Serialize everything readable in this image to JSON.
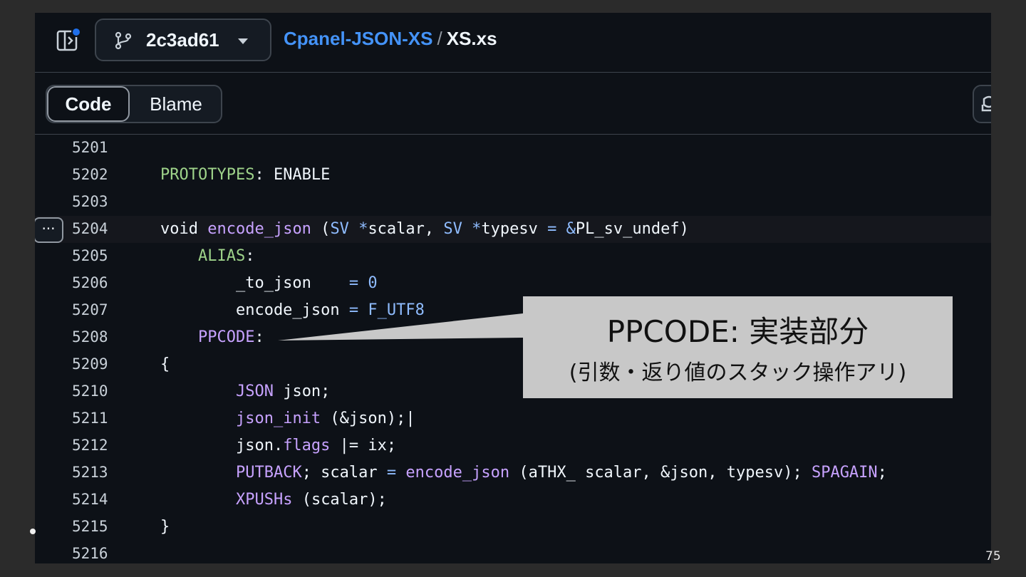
{
  "header": {
    "branch": "2c3ad61",
    "repo": "Cpanel-JSON-XS",
    "separator": "/",
    "file": "XS.xs"
  },
  "tabs": [
    {
      "label": "Code",
      "active": true
    },
    {
      "label": "Blame",
      "active": false
    }
  ],
  "code_lines": [
    {
      "n": "5201",
      "tokens": []
    },
    {
      "n": "5202",
      "tokens": [
        [
          "PROTOTYPES",
          "green"
        ],
        [
          ": ENABLE",
          "plain"
        ]
      ]
    },
    {
      "n": "5203",
      "tokens": []
    },
    {
      "n": "5204",
      "tokens": [
        [
          "void ",
          "plain"
        ],
        [
          "encode_json",
          "purple"
        ],
        [
          " (",
          "plain"
        ],
        [
          "SV",
          "blue"
        ],
        [
          " ",
          "plain"
        ],
        [
          "*",
          "blue"
        ],
        [
          "scalar, ",
          "plain"
        ],
        [
          "SV",
          "blue"
        ],
        [
          " ",
          "plain"
        ],
        [
          "*",
          "blue"
        ],
        [
          "typesv ",
          "plain"
        ],
        [
          "=",
          "blue"
        ],
        [
          " ",
          "plain"
        ],
        [
          "&",
          "blue"
        ],
        [
          "PL_sv_undef)",
          "plain"
        ]
      ]
    },
    {
      "n": "5205",
      "tokens": [
        [
          "    ",
          "plain"
        ],
        [
          "ALIAS",
          "green"
        ],
        [
          ":",
          "plain"
        ]
      ]
    },
    {
      "n": "5206",
      "tokens": [
        [
          "        _to_json    ",
          "plain"
        ],
        [
          "= 0",
          "blue"
        ]
      ]
    },
    {
      "n": "5207",
      "tokens": [
        [
          "        encode_json ",
          "plain"
        ],
        [
          "= F_UTF8",
          "blue"
        ]
      ]
    },
    {
      "n": "5208",
      "tokens": [
        [
          "    ",
          "plain"
        ],
        [
          "PPCODE",
          "purple"
        ],
        [
          ":",
          "plain"
        ]
      ]
    },
    {
      "n": "5209",
      "tokens": [
        [
          "{",
          "plain"
        ]
      ]
    },
    {
      "n": "5210",
      "tokens": [
        [
          "        ",
          "plain"
        ],
        [
          "JSON",
          "purple"
        ],
        [
          " json;",
          "plain"
        ]
      ]
    },
    {
      "n": "5211",
      "tokens": [
        [
          "        ",
          "plain"
        ],
        [
          "json_init",
          "purple"
        ],
        [
          " (&json);",
          "plain"
        ],
        [
          "|",
          "caret"
        ]
      ]
    },
    {
      "n": "5212",
      "tokens": [
        [
          "        json.",
          "plain"
        ],
        [
          "flags",
          "purple"
        ],
        [
          " |= ix;",
          "plain"
        ]
      ]
    },
    {
      "n": "5213",
      "tokens": [
        [
          "        ",
          "plain"
        ],
        [
          "PUTBACK",
          "purple"
        ],
        [
          "; scalar ",
          "plain"
        ],
        [
          "=",
          "blue"
        ],
        [
          " ",
          "plain"
        ],
        [
          "encode_json",
          "purple"
        ],
        [
          " (aTHX_ scalar, &json, typesv); ",
          "plain"
        ],
        [
          "SPAGAIN",
          "purple"
        ],
        [
          ";",
          "plain"
        ]
      ]
    },
    {
      "n": "5214",
      "tokens": [
        [
          "        ",
          "plain"
        ],
        [
          "XPUSHs",
          "purple"
        ],
        [
          " (scalar);",
          "plain"
        ]
      ]
    },
    {
      "n": "5215",
      "tokens": [
        [
          "}",
          "plain"
        ]
      ]
    },
    {
      "n": "5216",
      "tokens": []
    }
  ],
  "highlighted_line": "5204",
  "expand_button_label": "···",
  "callout": {
    "title": "PPCODE: 実装部分",
    "subtitle": "(引数・返り値のスタック操作アリ)"
  },
  "slide_number": "75",
  "colors": {
    "plain": "#f0f6fc",
    "green": "#9ed38a",
    "purple": "#c7a2ff",
    "blue": "#8fbcff"
  }
}
